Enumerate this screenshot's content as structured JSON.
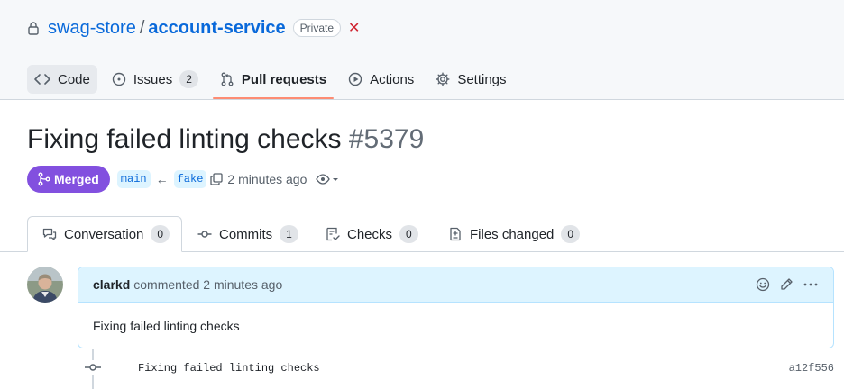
{
  "repo": {
    "owner": "swag-store",
    "separator": "/",
    "name": "account-service",
    "visibility": "Private",
    "close_glyph": "✕"
  },
  "nav": [
    {
      "label": "Code",
      "icon": "code-icon"
    },
    {
      "label": "Issues",
      "icon": "issue-icon",
      "count": "2"
    },
    {
      "label": "Pull requests",
      "icon": "pull-request-icon"
    },
    {
      "label": "Actions",
      "icon": "play-icon"
    },
    {
      "label": "Settings",
      "icon": "gear-icon"
    }
  ],
  "pr": {
    "title": "Fixing failed linting checks",
    "number": "#5379",
    "state": "Merged",
    "base_branch": "main",
    "head_branch": "fake",
    "arrow": "←",
    "time": "2 minutes ago"
  },
  "tabs": [
    {
      "label": "Conversation",
      "count": "0"
    },
    {
      "label": "Commits",
      "count": "1"
    },
    {
      "label": "Checks",
      "count": "0"
    },
    {
      "label": "Files changed",
      "count": "0"
    }
  ],
  "comment": {
    "author": "clarkd",
    "action": "commented 2 minutes ago",
    "body": "Fixing failed linting checks"
  },
  "commit": {
    "message": "Fixing failed linting checks",
    "sha": "a12f556"
  },
  "colors": {
    "accent": "#0969da",
    "merged": "#8250df",
    "selected_underline": "#fd8c73",
    "comment_header": "#ddf4ff"
  }
}
